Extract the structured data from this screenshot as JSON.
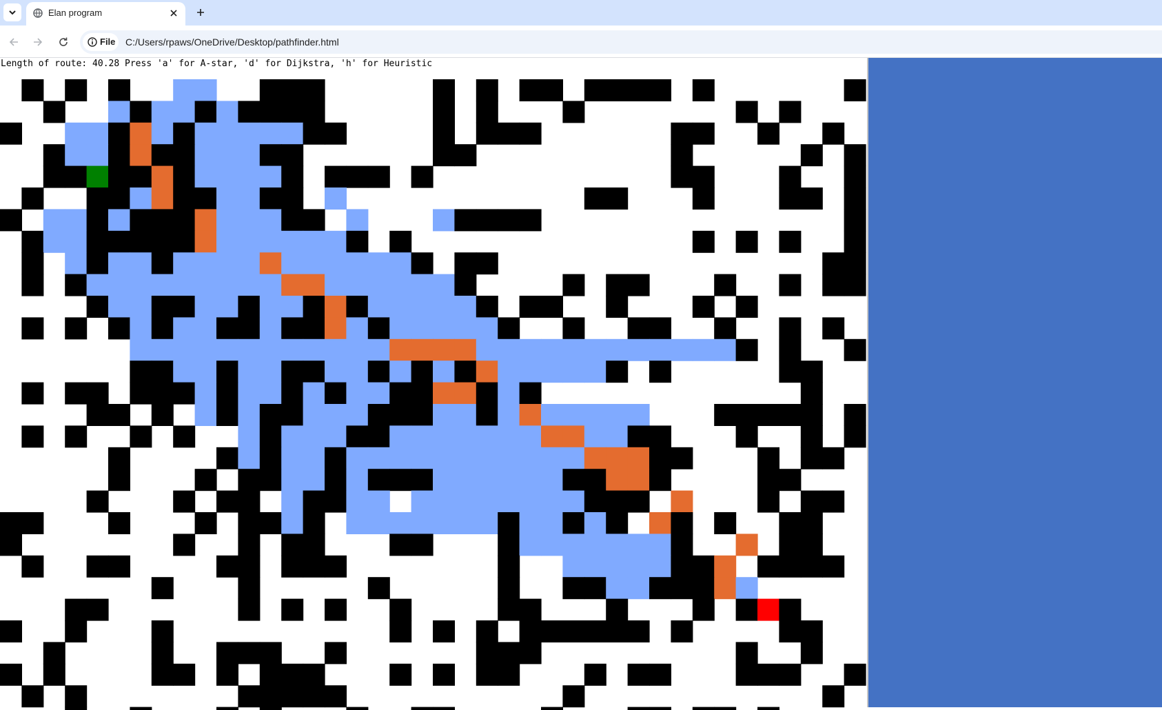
{
  "browser": {
    "tab_title": "Elan program",
    "url_scheme_label": "File",
    "url": "C:/Users/rpaws/OneDrive/Desktop/pathfinder.html"
  },
  "program": {
    "status_text": "Length of route: 40.28 Press 'a' for A-star, 'd' for Dijkstra, 'h' for Heuristic"
  },
  "colors": {
    "wall": "#000000",
    "open": "#ffffff",
    "explored": "#80aaff",
    "route": "#e46c2f",
    "start": "#008000",
    "goal": "#ff0000",
    "panel": "#4472c4"
  },
  "icons": {
    "tab_search": "chevron-down-icon",
    "favicon": "globe-icon",
    "close": "close-icon",
    "new_tab": "plus-icon",
    "back": "back-arrow-icon",
    "forward": "forward-arrow-icon",
    "reload": "reload-icon",
    "info": "info-icon"
  },
  "grid": {
    "legend": "#=wall, .=open, e=explored, o=route, S=start, G=goal",
    "rows": [
      ".#.#.#..ee..###.....#.#.##.####.#......#",
      "..#..e#ee#e####.....#.#...#.......#.#...",
      "#..ee#oe#eeeee##....#.###......##..#..#.",
      "..#ee#o##eee##......##.........#.....#.#",
      "..##S##o#eeee#.###.#...........##...#..#",
      ".#..##eo##ee##.e...........##...#...##.#",
      "#.ee#e###oeee##.e...e####..............#",
      ".#ee#####oeeeeee#.#.............#.#.#..#",
      ".#.e#ee#eeeeoeeeeee#.##...............##",
      ".#.#eeeeeeeeeooeeeeee#....#.##...#..#.##",
      "....#ee##ee#ee#o#eeeee#.##..#...#.#.....",
      ".#.#.#e#ee##e##oe#eeeee#..#..##..#..#.#.",
      "......eeeeeeeeeeeeooooeeeeeeeeeeee#.#..#",
      "......##ee#ee##ee#e#e#oeeeee#.#.....##...",
      ".#.##.###e#ee#e#ee##oo#e#............#..",
      "....##.#.e#e##eee###ee#eoeeeee...#####.#",
      ".#.#..#.#..e#eee##eeeeeeeooee##...#..#.#",
      ".....#....#e#ee#eeeeeeeeeeeooo##...#.##.",
      ".....#...#.##ee#e###eeeeee##oo#....##...",
      "....#...#.##.e##ee.eeeeeeee###.o...#.##.",
      "##...#...#.##e#.eeeeeee#ee#e#.o#.#..##..",
      "#.......#..#.##...##...#eeeeeee#..o.##.",
      ".#..##....##.###.......#..eeeee##o.####.",
      ".......#...#.....#.....#..##ee###oe....",
      "...##......#.#.#..#....##...#...#.#G#...",
      "#..#...#..........#.#.#.######.#....##.",
      "..#....#..###..#......###.........#..#..",
      "#.#....##.#.###...#.#.##...#.##...###..#",
      ".#.#.......#####..........#...........#.",
      "...#..#...#.#...#..##....#...##.##.#....."
    ]
  }
}
